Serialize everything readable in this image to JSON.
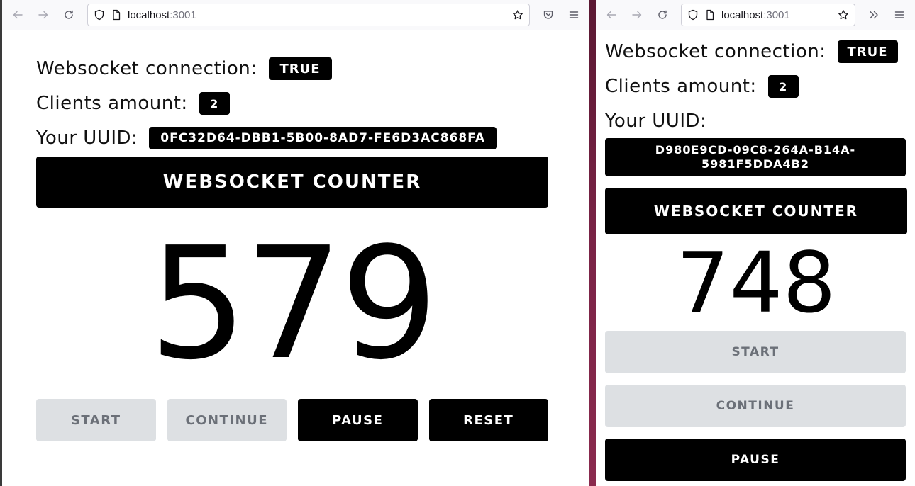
{
  "browser_left": {
    "url_host": "localhost",
    "url_port": ":3001",
    "page": {
      "ws_label": "Websocket connection:",
      "ws_value": "TRUE",
      "clients_label": "Clients amount:",
      "clients_value": "2",
      "uuid_label": "Your UUID:",
      "uuid_value": "0FC32D64-DBB1-5B00-8AD7-FE6D3AC868FA",
      "title": "WEBSOCKET COUNTER",
      "counter": "579",
      "buttons": [
        {
          "label": "START",
          "state": "disabled"
        },
        {
          "label": "CONTINUE",
          "state": "disabled"
        },
        {
          "label": "PAUSE",
          "state": "active"
        },
        {
          "label": "RESET",
          "state": "active"
        }
      ]
    }
  },
  "browser_right": {
    "url_host": "localhost",
    "url_port": ":3001",
    "page": {
      "ws_label": "Websocket connection:",
      "ws_value": "TRUE",
      "clients_label": "Clients amount:",
      "clients_value": "2",
      "uuid_label": "Your UUID:",
      "uuid_value": "D980E9CD-09C8-264A-B14A-5981F5DDA4B2",
      "title": "WEBSOCKET COUNTER",
      "counter": "748",
      "buttons": [
        {
          "label": "START",
          "state": "disabled"
        },
        {
          "label": "CONTINUE",
          "state": "disabled"
        },
        {
          "label": "PAUSE",
          "state": "active"
        }
      ]
    }
  },
  "colors": {
    "desktop_bg": "#6e1f3c",
    "badge_bg": "#000000",
    "disabled_btn_bg": "#dde0e3",
    "disabled_btn_text": "#6b7078"
  },
  "icons": [
    "back-arrow-icon",
    "forward-arrow-icon",
    "reload-icon",
    "shield-icon",
    "page-icon",
    "star-icon",
    "pocket-icon",
    "menu-icon",
    "overflow-chevrons-icon"
  ]
}
